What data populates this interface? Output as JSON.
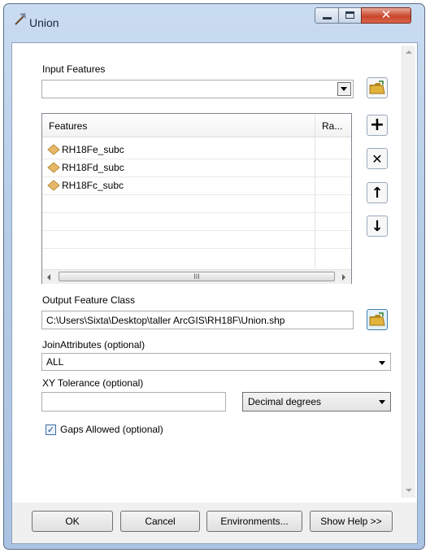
{
  "window": {
    "title": "Union"
  },
  "input_features": {
    "label": "Input Features",
    "value": ""
  },
  "features_list": {
    "header_features": "Features",
    "header_rank": "Ra...",
    "items": [
      "RH18Fe_subc",
      "RH18Fd_subc",
      "RH18Fc_subc"
    ],
    "hscroll_grip": "III"
  },
  "output_feature_class": {
    "label": "Output Feature Class",
    "value": "C:\\Users\\Sixta\\Desktop\\taller ArcGIS\\RH18F\\Union.shp"
  },
  "join_attributes": {
    "label": "JoinAttributes (optional)",
    "value": "ALL"
  },
  "xy_tolerance": {
    "label": "XY Tolerance (optional)",
    "value": "",
    "unit": "Decimal degrees"
  },
  "gaps_allowed": {
    "label": "Gaps Allowed (optional)",
    "checked": true
  },
  "buttons": {
    "ok": "OK",
    "cancel": "Cancel",
    "environments": "Environments...",
    "show_help": "Show Help >>"
  },
  "colors": {
    "folder": "#e2b33c",
    "feature_icon": "#e6b96a"
  }
}
